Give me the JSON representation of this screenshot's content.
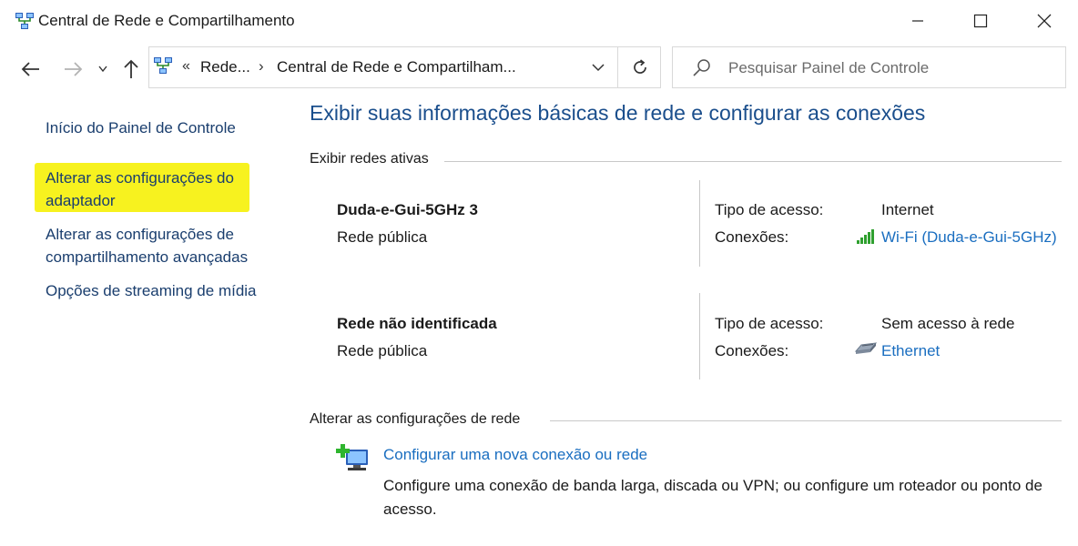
{
  "window": {
    "title": "Central de Rede e Compartilhamento"
  },
  "address_bar": {
    "overflow": "«",
    "segments": [
      "Rede...",
      "Central de Rede e Compartilham..."
    ],
    "separator": "›"
  },
  "search": {
    "placeholder": "Pesquisar Painel de Controle"
  },
  "sidebar": {
    "items": [
      {
        "label": "Início do Painel de Controle"
      },
      {
        "label": "Alterar as configurações do",
        "label2": "adaptador"
      },
      {
        "label": "Alterar as configurações de",
        "label2": "compartilhamento avançadas"
      },
      {
        "label": "Opções de streaming de mídia"
      }
    ]
  },
  "main": {
    "heading": "Exibir suas informações básicas de rede e configurar as conexões",
    "active_networks_label": "Exibir redes ativas",
    "networks": [
      {
        "name": "Duda-e-Gui-5GHz 3",
        "category": "Rede pública",
        "access_label": "Tipo de acesso:",
        "access_value": "Internet",
        "connections_label": "Conexões:",
        "connection": "Wi-Fi (Duda-e-Gui-5GHz)",
        "connection_icon": "wifi-signal-icon"
      },
      {
        "name": "Rede não identificada",
        "category": "Rede pública",
        "access_label": "Tipo de acesso:",
        "access_value": "Sem acesso à rede",
        "connections_label": "Conexões:",
        "connection": "Ethernet",
        "connection_icon": "ethernet-icon"
      }
    ],
    "change_settings_label": "Alterar as configurações de rede",
    "tasks": [
      {
        "link": "Configurar uma nova conexão ou rede",
        "description": "Configure uma conexão de banda larga, discada ou VPN; ou configure um roteador ou ponto de acesso."
      }
    ]
  },
  "colors": {
    "link": "#1a6ec0",
    "heading": "#1a4e8c",
    "highlight": "#f7f21f"
  }
}
